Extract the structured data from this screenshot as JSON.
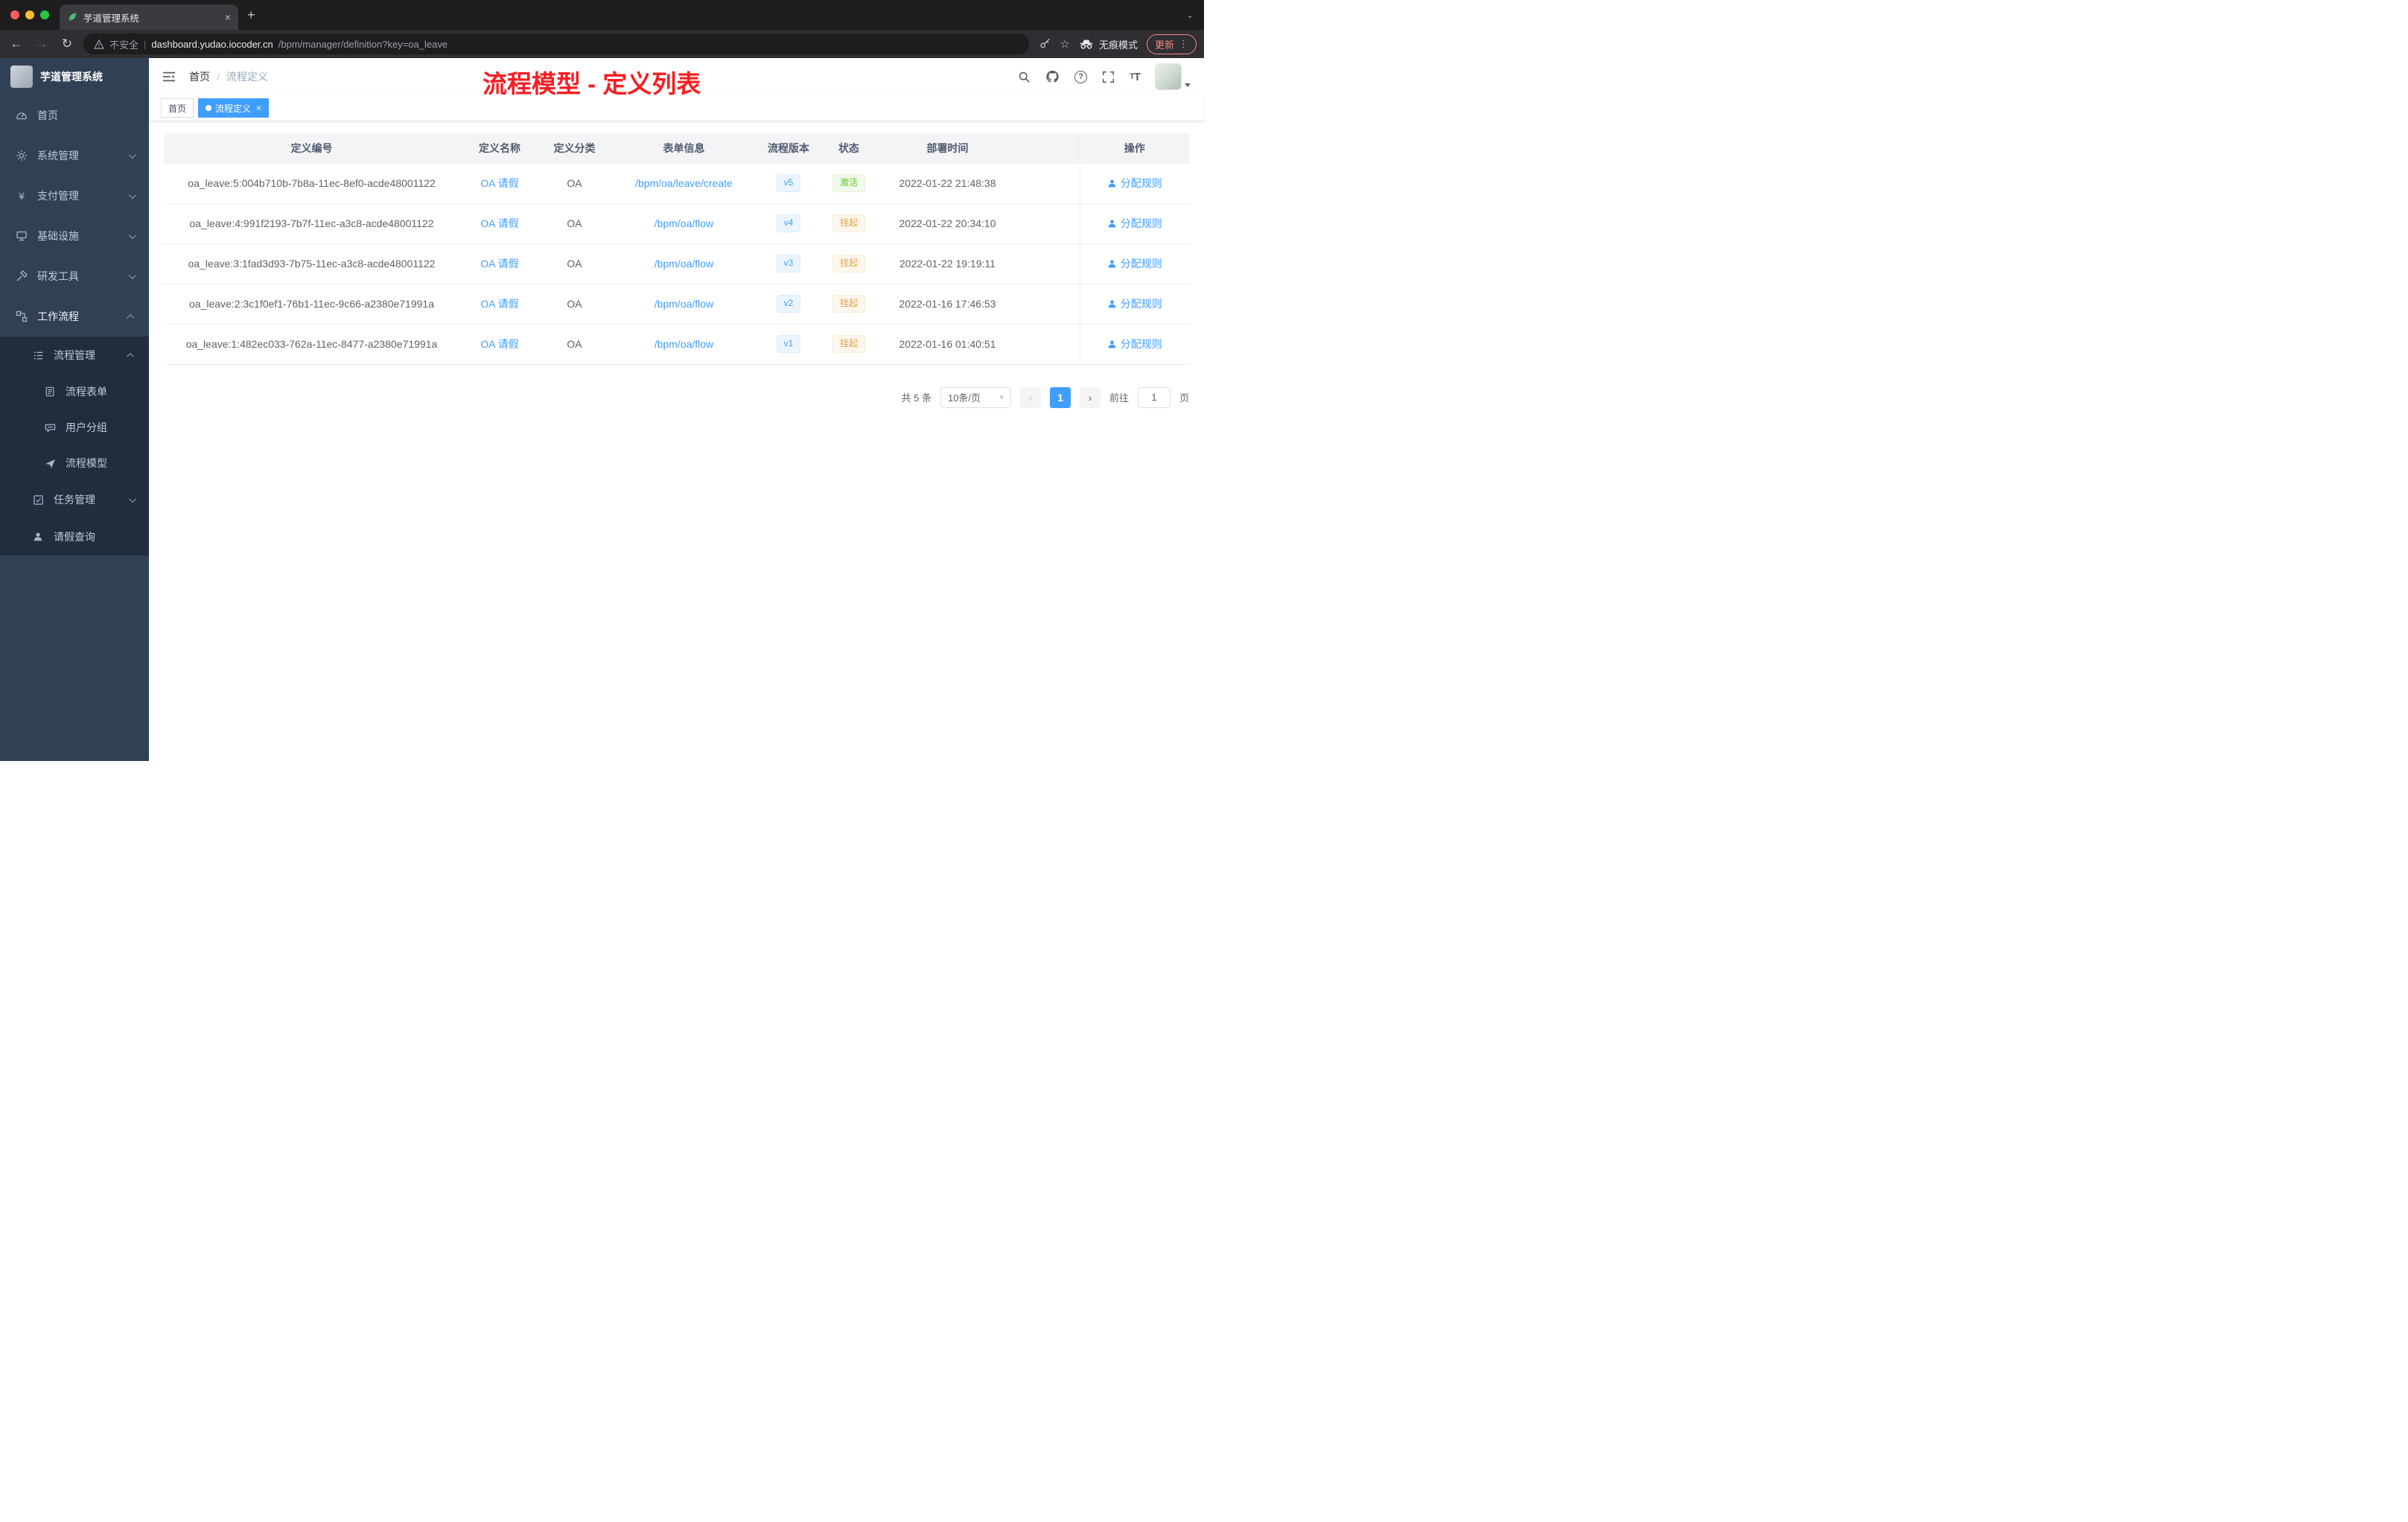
{
  "browser": {
    "tab_title": "芋道管理系统",
    "new_tab_glyph": "+",
    "back_glyph": "←",
    "forward_glyph": "→",
    "reload_glyph": "↻",
    "security_label": "不安全",
    "url_domain": "dashboard.yudao.iocoder.cn",
    "url_path": "/bpm/manager/definition?key=oa_leave",
    "incognito_label": "无痕模式",
    "update_label": "更新",
    "menu_dots": "⋮",
    "star_glyph": "☆"
  },
  "sidebar": {
    "brand": "芋道管理系统",
    "items": [
      {
        "label": "首页"
      },
      {
        "label": "系统管理"
      },
      {
        "label": "支付管理"
      },
      {
        "label": "基础设施"
      },
      {
        "label": "研发工具"
      },
      {
        "label": "工作流程"
      },
      {
        "label": "流程管理"
      },
      {
        "label": "流程表单"
      },
      {
        "label": "用户分组"
      },
      {
        "label": "流程模型"
      },
      {
        "label": "任务管理"
      },
      {
        "label": "请假查询"
      }
    ],
    "yen_glyph": "¥"
  },
  "navbar": {
    "breadcrumb_home": "首页",
    "breadcrumb_separator": "/",
    "breadcrumb_current": "流程定义",
    "annotation": "流程模型 - 定义列表",
    "question_glyph": "?"
  },
  "tags": [
    {
      "label": "首页"
    },
    {
      "label": "流程定义",
      "close_glyph": "×"
    }
  ],
  "table": {
    "columns": [
      "定义编号",
      "定义名称",
      "定义分类",
      "表单信息",
      "流程版本",
      "状态",
      "部署时间",
      "操作"
    ],
    "action_label": "分配规则",
    "rows": [
      {
        "id": "oa_leave:5:004b710b-7b8a-11ec-8ef0-acde48001122",
        "name": "OA 请假",
        "category": "OA",
        "form": "/bpm/oa/leave/create",
        "version": "v5",
        "status": "激活",
        "time": "2022-01-22 21:48:38"
      },
      {
        "id": "oa_leave:4:991f2193-7b7f-11ec-a3c8-acde48001122",
        "name": "OA 请假",
        "category": "OA",
        "form": "/bpm/oa/flow",
        "version": "v4",
        "status": "挂起",
        "time": "2022-01-22 20:34:10"
      },
      {
        "id": "oa_leave:3:1fad3d93-7b75-11ec-a3c8-acde48001122",
        "name": "OA 请假",
        "category": "OA",
        "form": "/bpm/oa/flow",
        "version": "v3",
        "status": "挂起",
        "time": "2022-01-22 19:19:11"
      },
      {
        "id": "oa_leave:2:3c1f0ef1-76b1-11ec-9c66-a2380e71991a",
        "name": "OA 请假",
        "category": "OA",
        "form": "/bpm/oa/flow",
        "version": "v2",
        "status": "挂起",
        "time": "2022-01-16 17:46:53"
      },
      {
        "id": "oa_leave:1:482ec033-762a-11ec-8477-a2380e71991a",
        "name": "OA 请假",
        "category": "OA",
        "form": "/bpm/oa/flow",
        "version": "v1",
        "status": "挂起",
        "time": "2022-01-16 01:40:51"
      }
    ]
  },
  "pagination": {
    "total": "共 5 条",
    "page_size": "10条/页",
    "caret": "▾",
    "prev_glyph": "‹",
    "next_glyph": "›",
    "current_page": "1",
    "goto_label": "前往",
    "goto_value": "1",
    "page_unit": "页"
  },
  "colors": {
    "accent": "#409eff",
    "success": "#67c23a",
    "warning": "#e6a23c",
    "annotation_red": "#f81d22",
    "sidebar_bg": "#304156",
    "submenu_bg": "#1f2d3d",
    "traffic_red": "#ff5f57",
    "traffic_yellow": "#febc2e",
    "traffic_green": "#28c840"
  }
}
